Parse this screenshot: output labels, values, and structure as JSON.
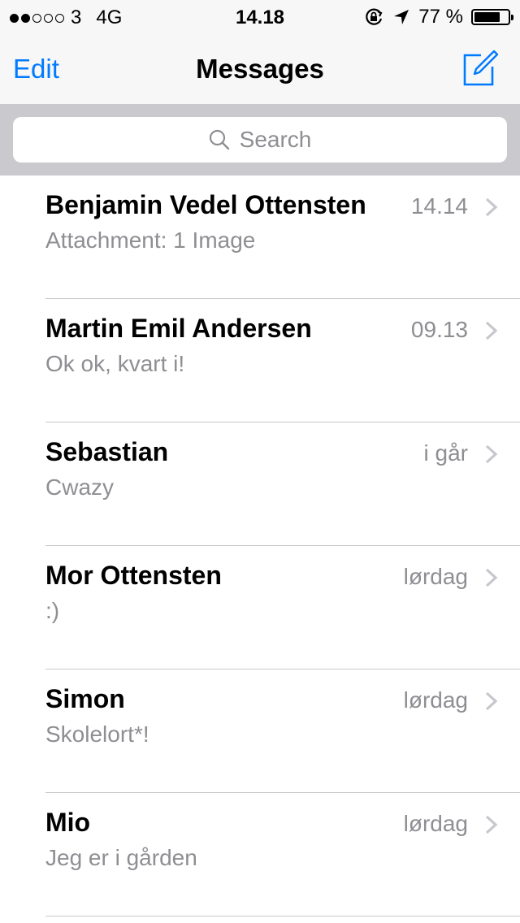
{
  "status_bar": {
    "signal_dots_filled": 2,
    "signal_dots_total": 5,
    "carrier": "3",
    "network": "4G",
    "time": "14.18",
    "battery_percent_label": "77 %",
    "battery_level": 0.77,
    "icons": [
      "orientation-lock-icon",
      "location-arrow-icon",
      "battery-icon"
    ]
  },
  "nav": {
    "edit_label": "Edit",
    "title": "Messages",
    "compose_icon": "compose-icon",
    "accent_color": "#007aff"
  },
  "search": {
    "placeholder": "Search",
    "icon": "search-icon"
  },
  "conversations": [
    {
      "name": "Benjamin Vedel Ottensten",
      "time": "14.14",
      "preview": "Attachment: 1 Image"
    },
    {
      "name": "Martin Emil Andersen",
      "time": "09.13",
      "preview": "Ok ok, kvart i!"
    },
    {
      "name": "Sebastian",
      "time": "i går",
      "preview": "Cwazy"
    },
    {
      "name": "Mor Ottensten",
      "time": "lørdag",
      "preview": ":)"
    },
    {
      "name": "Simon",
      "time": "lørdag",
      "preview": "Skolelort*!"
    },
    {
      "name": "Mio",
      "time": "lørdag",
      "preview": "Jeg er i gården"
    }
  ]
}
